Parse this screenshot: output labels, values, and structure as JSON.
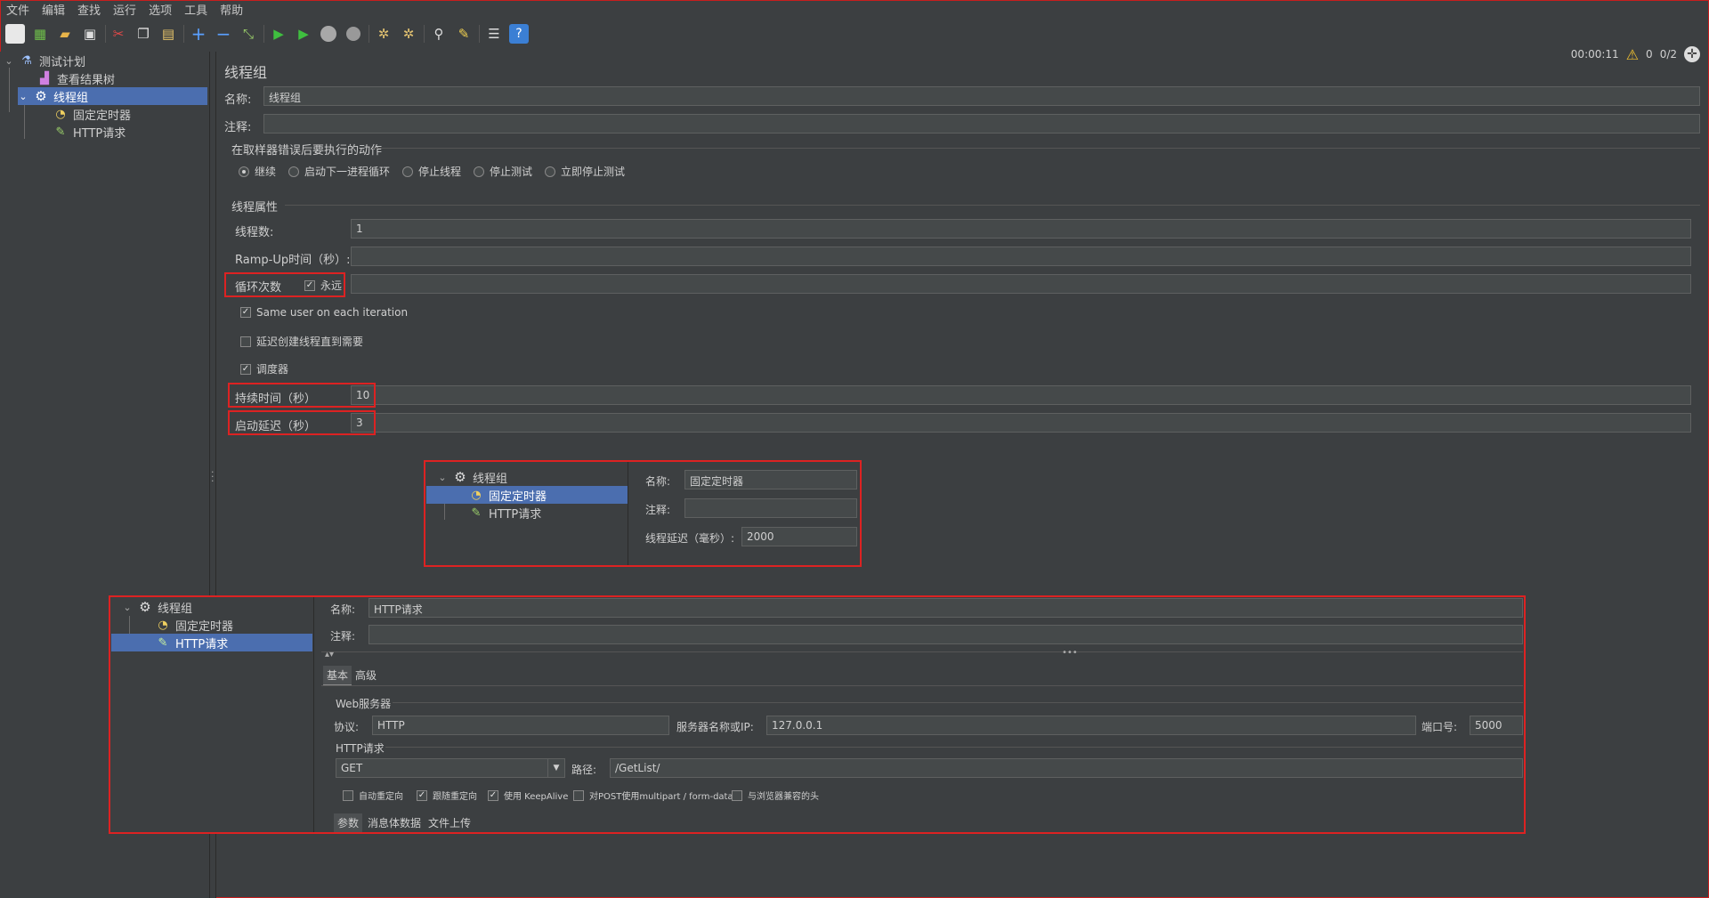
{
  "menu": [
    "文件",
    "编辑",
    "查找",
    "运行",
    "选项",
    "工具",
    "帮助"
  ],
  "status": {
    "time": "00:00:11",
    "warnings": "0",
    "threads": "0/2"
  },
  "tree": {
    "root": "测试计划",
    "items": [
      "查看结果树",
      "线程组",
      "固定定时器",
      "HTTP请求"
    ]
  },
  "panel": {
    "title": "线程组",
    "name_label": "名称:",
    "name_value": "线程组",
    "comment_label": "注释:",
    "comment_value": "",
    "error_section": "在取样器错误后要执行的动作",
    "error_options": [
      "继续",
      "启动下一进程循环",
      "停止线程",
      "停止测试",
      "立即停止测试"
    ],
    "thread_section": "线程属性",
    "threads_label": "线程数:",
    "threads_value": "1",
    "rampup_label": "Ramp-Up时间（秒）:",
    "rampup_value": "",
    "loop_label": "循环次数",
    "loop_forever": "永远",
    "loop_value": "",
    "same_user": "Same user on each iteration",
    "delay_create": "延迟创建线程直到需要",
    "scheduler": "调度器",
    "duration_label": "持续时间（秒）",
    "duration_value": "10",
    "startup_delay_label": "启动延迟（秒）",
    "startup_delay_value": "3"
  },
  "timer_inset": {
    "tree": [
      "线程组",
      "固定定时器",
      "HTTP请求"
    ],
    "name_label": "名称:",
    "name_value": "固定定时器",
    "comment_label": "注释:",
    "comment_value": "",
    "delay_label": "线程延迟（毫秒）:",
    "delay_value": "2000"
  },
  "http_inset": {
    "tree": [
      "线程组",
      "固定定时器",
      "HTTP请求"
    ],
    "name_label": "名称:",
    "name_value": "HTTP请求",
    "comment_label": "注释:",
    "comment_value": "",
    "tabs": [
      "基本",
      "高级"
    ],
    "web_server_section": "Web服务器",
    "protocol_label": "协议:",
    "protocol_value": "HTTP",
    "server_label": "服务器名称或IP:",
    "server_value": "127.0.0.1",
    "port_label": "端口号:",
    "port_value": "5000",
    "http_section": "HTTP请求",
    "method_value": "GET",
    "path_label": "路径:",
    "path_value": "/GetList/",
    "options": [
      "自动重定向",
      "跟随重定向",
      "使用 KeepAlive",
      "对POST使用multipart / form-data",
      "与浏览器兼容的头"
    ],
    "bottom_tabs": [
      "参数",
      "消息体数据",
      "文件上传"
    ]
  }
}
